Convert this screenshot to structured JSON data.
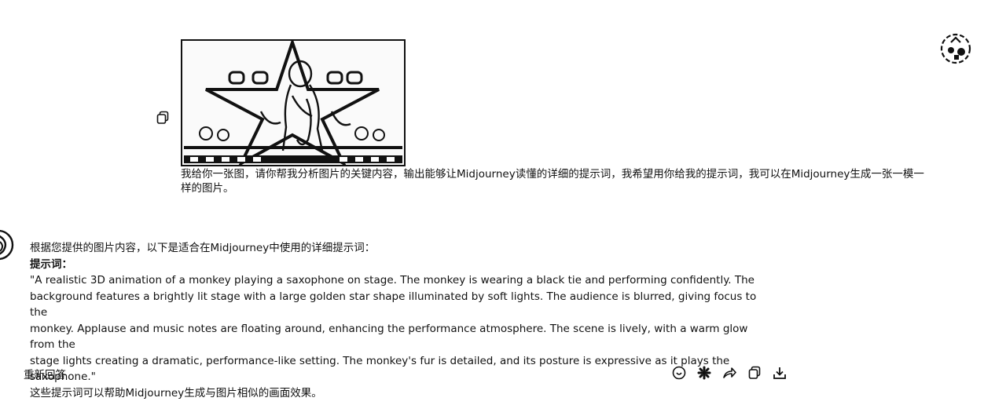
{
  "user_message": {
    "text": "我给你一张图，请你帮我分析图片的关键内容，输出能够让Midjourney读懂的详细的提示词，我希望用你给我的提示词，我可以在Midjourney生成一张一模一样的图片。",
    "image": {
      "icon": "uploaded-image",
      "description": "stage-with-star"
    },
    "copy_icon": "copy-icon",
    "avatar_icon": "user-avatar"
  },
  "assistant_message": {
    "avatar_icon": "assistant-avatar",
    "intro": "根据您提供的图片内容，以下是适合在Midjourney中使用的详细提示词：",
    "prompt_heading": "提示词：",
    "prompt_lines": [
      "\"A realistic 3D animation of a monkey playing a saxophone on stage. The monkey is wearing a black tie and performing confidently. The",
      "background features a brightly lit stage with a large golden star shape illuminated by soft lights. The audience is blurred, giving focus to the",
      "monkey. Applause and music notes are floating around, enhancing the performance atmosphere. The scene is lively, with a warm glow from the",
      "stage lights creating a dramatic, performance-like setting. The monkey's fur is detailed, and its posture is expressive as it plays the saxophone.\""
    ],
    "closing": "这些提示词可以帮助Midjourney生成与图片相似的画面效果。"
  },
  "footer": {
    "regenerate_label": "重新回答",
    "tools": [
      "smile-icon",
      "gear-icon",
      "share-icon",
      "copy-icon",
      "download-icon"
    ]
  },
  "colors": {
    "text": "#111111",
    "background": "#ffffff"
  }
}
